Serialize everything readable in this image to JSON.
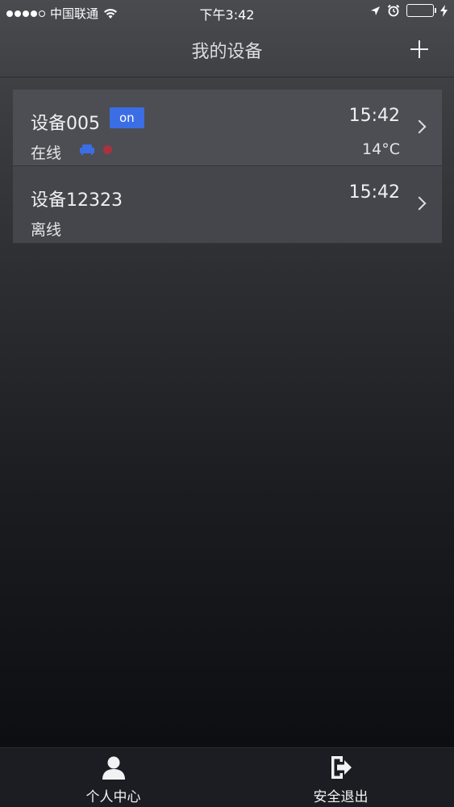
{
  "status_bar": {
    "carrier": "中国联通",
    "time": "下午3:42",
    "signal_icon": "signal-dots-icon",
    "wifi_icon": "wifi-icon",
    "location_icon": "location-arrow-icon",
    "alarm_icon": "alarm-clock-icon",
    "battery_icon": "battery-icon",
    "charging_icon": "charging-bolt-icon",
    "battery_color": "#4cd964"
  },
  "nav": {
    "title": "我的设备",
    "add_icon": "plus-icon"
  },
  "devices": [
    {
      "name": "设备005",
      "badge": "on",
      "time": "15:42",
      "status": "在线",
      "temperature": "14°C",
      "mode_icon": "sofa-icon",
      "mode_icon_color": "#3b6de5",
      "alert_color": "#a8333f"
    },
    {
      "name": "设备12323",
      "time": "15:42",
      "status": "离线"
    }
  ],
  "tab_bar": {
    "items": [
      {
        "label": "个人中心",
        "icon": "person-icon"
      },
      {
        "label": "安全退出",
        "icon": "exit-door-icon"
      }
    ]
  },
  "colors": {
    "accent": "#3b6de5",
    "row_background": "#4d4e53",
    "tab_background": "#1c1d22"
  }
}
